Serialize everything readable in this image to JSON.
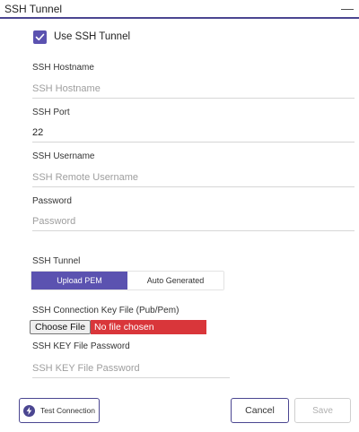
{
  "section": {
    "title": "SSH Tunnel",
    "collapse_glyph": "—"
  },
  "use_ssh_tunnel": {
    "label": "Use SSH Tunnel",
    "checked": true
  },
  "fields": {
    "hostname": {
      "label": "SSH Hostname",
      "value": "",
      "placeholder": "SSH Hostname"
    },
    "port": {
      "label": "SSH Port",
      "value": "22",
      "placeholder": ""
    },
    "username": {
      "label": "SSH Username",
      "value": "",
      "placeholder": "SSH Remote Username"
    },
    "password": {
      "label": "Password",
      "value": "",
      "placeholder": "Password"
    },
    "key_password": {
      "label": "SSH KEY File Password",
      "value": "",
      "placeholder": "SSH KEY File Password"
    }
  },
  "tunnel_mode": {
    "label": "SSH Tunnel",
    "options": [
      "Upload PEM",
      "Auto Generated"
    ],
    "selected": "Upload PEM"
  },
  "key_file": {
    "label": "SSH Connection Key File (Pub/Pem)",
    "button_label": "Choose File",
    "status": "No file chosen"
  },
  "actions": {
    "test_label": "Test Connection",
    "cancel_label": "Cancel",
    "save_label": "Save"
  },
  "colors": {
    "accent": "#5b52b0",
    "accent_dark": "#4b4691",
    "error": "#d9363a"
  }
}
